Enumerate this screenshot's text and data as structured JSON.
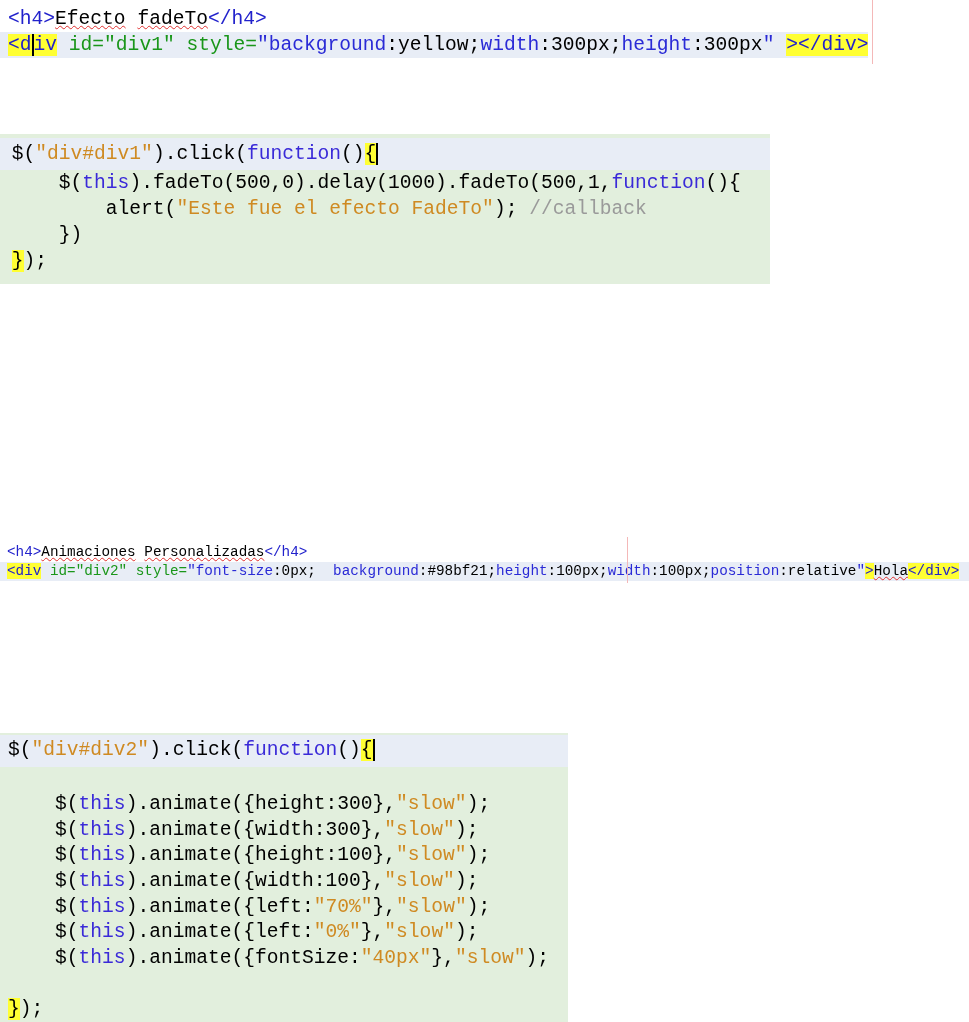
{
  "snippets": [
    {
      "kind": "html",
      "lines": [
        {
          "kind": "code",
          "current": false,
          "tokens": [
            {
              "t": "<h4>",
              "kind": "tag"
            },
            {
              "t": "Efecto",
              "kind": "plain",
              "misspelled": true
            },
            {
              "t": " fadeTo",
              "kind": "plain",
              "misspelled": true
            },
            {
              "t": "</h4>",
              "kind": "tag"
            }
          ]
        },
        {
          "kind": "code",
          "current": true,
          "tokens": [
            {
              "t": "<d",
              "kind": "tag",
              "match": true,
              "caret": true
            },
            {
              "t": "iv",
              "kind": "tag",
              "match": true
            },
            {
              "t": " id=\"div1\" style=",
              "kind": "attr"
            },
            {
              "t": "\"background",
              "kind": "prop"
            },
            {
              "t": ":yellow;",
              "kind": "plain"
            },
            {
              "t": "width",
              "kind": "prop"
            },
            {
              "t": ":300px;",
              "kind": "plain"
            },
            {
              "t": "height",
              "kind": "prop"
            },
            {
              "t": ":300px",
              "kind": "plain"
            },
            {
              "t": "\"",
              "kind": "prop"
            },
            {
              "t": " ></div>",
              "kind": "tag",
              "match": true
            }
          ]
        }
      ]
    },
    {
      "kind": "js",
      "lines": [
        {
          "kind": "code",
          "current": true,
          "tokens": [
            {
              "t": " $(",
              "kind": "plain"
            },
            {
              "t": "\"div#div1\"",
              "kind": "string"
            },
            {
              "t": ").click(",
              "kind": "plain"
            },
            {
              "t": "function",
              "kind": "keyword"
            },
            {
              "t": "()",
              "kind": "plain"
            },
            {
              "t": "{",
              "kind": "plain",
              "match": true,
              "caret": true
            }
          ]
        },
        {
          "kind": "code",
          "current": false,
          "tokens": [
            {
              "t": "     $(",
              "kind": "plain"
            },
            {
              "t": "this",
              "kind": "keyword"
            },
            {
              "t": ").fadeTo(500,0).delay(1000).fadeTo(500,1,",
              "kind": "plain"
            },
            {
              "t": "function",
              "kind": "keyword"
            },
            {
              "t": "(){",
              "kind": "plain"
            }
          ]
        },
        {
          "kind": "code",
          "current": false,
          "tokens": [
            {
              "t": "         alert(",
              "kind": "plain"
            },
            {
              "t": "\"Este fue el efecto FadeTo\"",
              "kind": "string"
            },
            {
              "t": "); ",
              "kind": "plain"
            },
            {
              "t": "//callback",
              "kind": "comment"
            }
          ]
        },
        {
          "kind": "code",
          "current": false,
          "tokens": [
            {
              "t": "     })",
              "kind": "plain"
            }
          ]
        },
        {
          "kind": "code",
          "current": false,
          "tokens": [
            {
              "t": " }",
              "kind": "plain",
              "match": true
            },
            {
              "t": ");",
              "kind": "plain"
            }
          ]
        }
      ]
    },
    {
      "kind": "html",
      "lines": [
        {
          "kind": "code",
          "current": false,
          "tokens": [
            {
              "t": "<h4>",
              "kind": "tag"
            },
            {
              "t": "Animaciones",
              "kind": "plain",
              "misspelled": true
            },
            {
              "t": " Personalizadas",
              "kind": "plain",
              "misspelled": true
            },
            {
              "t": "</h4>",
              "kind": "tag"
            }
          ]
        },
        {
          "kind": "code",
          "current": true,
          "tokens": [
            {
              "t": "<div",
              "kind": "tag",
              "match": true
            },
            {
              "t": " id=\"div2\" style=",
              "kind": "attr"
            },
            {
              "t": "\"font-size",
              "kind": "prop"
            },
            {
              "t": ":0px;  ",
              "kind": "plain"
            },
            {
              "t": "background",
              "kind": "prop"
            },
            {
              "t": ":#98bf21;",
              "kind": "plain"
            },
            {
              "t": "height",
              "kind": "prop"
            },
            {
              "t": ":100px;",
              "kind": "plain"
            },
            {
              "t": "width",
              "kind": "prop"
            },
            {
              "t": ":100px;",
              "kind": "plain"
            },
            {
              "t": "position",
              "kind": "prop"
            },
            {
              "t": ":relative",
              "kind": "plain"
            },
            {
              "t": "\"",
              "kind": "prop"
            },
            {
              "t": ">",
              "kind": "tag",
              "match": true
            },
            {
              "t": "Hola",
              "kind": "plain",
              "misspelled": true
            },
            {
              "t": "</div>",
              "kind": "tag",
              "match": true
            }
          ]
        }
      ]
    },
    {
      "kind": "js",
      "lines": [
        {
          "kind": "code",
          "current": true,
          "tokens": [
            {
              "t": "$(",
              "kind": "plain"
            },
            {
              "t": "\"div#div2\"",
              "kind": "string"
            },
            {
              "t": ").click(",
              "kind": "plain"
            },
            {
              "t": "function",
              "kind": "keyword"
            },
            {
              "t": "()",
              "kind": "plain"
            },
            {
              "t": "{",
              "kind": "plain",
              "match": true,
              "caret": true
            }
          ]
        },
        {
          "kind": "blank",
          "current": false
        },
        {
          "kind": "code",
          "current": false,
          "tokens": [
            {
              "t": "    $(",
              "kind": "plain"
            },
            {
              "t": "this",
              "kind": "keyword"
            },
            {
              "t": ").animate({height:300},",
              "kind": "plain"
            },
            {
              "t": "\"slow\"",
              "kind": "string"
            },
            {
              "t": ");",
              "kind": "plain"
            }
          ]
        },
        {
          "kind": "code",
          "current": false,
          "tokens": [
            {
              "t": "    $(",
              "kind": "plain"
            },
            {
              "t": "this",
              "kind": "keyword"
            },
            {
              "t": ").animate({width:300},",
              "kind": "plain"
            },
            {
              "t": "\"slow\"",
              "kind": "string"
            },
            {
              "t": ");",
              "kind": "plain"
            }
          ]
        },
        {
          "kind": "code",
          "current": false,
          "tokens": [
            {
              "t": "    $(",
              "kind": "plain"
            },
            {
              "t": "this",
              "kind": "keyword"
            },
            {
              "t": ").animate({height:100},",
              "kind": "plain"
            },
            {
              "t": "\"slow\"",
              "kind": "string"
            },
            {
              "t": ");",
              "kind": "plain"
            }
          ]
        },
        {
          "kind": "code",
          "current": false,
          "tokens": [
            {
              "t": "    $(",
              "kind": "plain"
            },
            {
              "t": "this",
              "kind": "keyword"
            },
            {
              "t": ").animate({width:100},",
              "kind": "plain"
            },
            {
              "t": "\"slow\"",
              "kind": "string"
            },
            {
              "t": ");",
              "kind": "plain"
            }
          ]
        },
        {
          "kind": "code",
          "current": false,
          "tokens": [
            {
              "t": "    $(",
              "kind": "plain"
            },
            {
              "t": "this",
              "kind": "keyword"
            },
            {
              "t": ").animate({left:",
              "kind": "plain"
            },
            {
              "t": "\"70%\"",
              "kind": "string"
            },
            {
              "t": "},",
              "kind": "plain"
            },
            {
              "t": "\"slow\"",
              "kind": "string"
            },
            {
              "t": ");",
              "kind": "plain"
            }
          ]
        },
        {
          "kind": "code",
          "current": false,
          "tokens": [
            {
              "t": "    $(",
              "kind": "plain"
            },
            {
              "t": "this",
              "kind": "keyword"
            },
            {
              "t": ").animate({left:",
              "kind": "plain"
            },
            {
              "t": "\"0%\"",
              "kind": "string"
            },
            {
              "t": "},",
              "kind": "plain"
            },
            {
              "t": "\"slow\"",
              "kind": "string"
            },
            {
              "t": ");",
              "kind": "plain"
            }
          ]
        },
        {
          "kind": "code",
          "current": false,
          "tokens": [
            {
              "t": "    $(",
              "kind": "plain"
            },
            {
              "t": "this",
              "kind": "keyword"
            },
            {
              "t": ").animate({fontSize:",
              "kind": "plain"
            },
            {
              "t": "\"40px\"",
              "kind": "string"
            },
            {
              "t": "},",
              "kind": "plain"
            },
            {
              "t": "\"slow\"",
              "kind": "string"
            },
            {
              "t": ");",
              "kind": "plain"
            }
          ]
        },
        {
          "kind": "blank",
          "current": false
        },
        {
          "kind": "code",
          "current": false,
          "tokens": [
            {
              "t": "}",
              "kind": "plain",
              "match": true
            },
            {
              "t": ");",
              "kind": "plain"
            }
          ]
        }
      ]
    }
  ]
}
